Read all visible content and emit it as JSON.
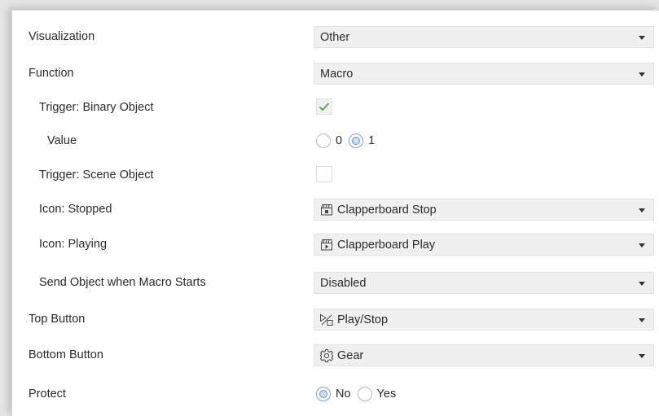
{
  "rows": [
    {
      "label": "Visualization",
      "type": "select",
      "value": "Other"
    },
    {
      "label": "Function",
      "type": "select",
      "value": "Macro"
    },
    {
      "label": "Trigger: Binary Object",
      "type": "checkbox",
      "checked": true
    },
    {
      "label": "Value",
      "type": "radio",
      "options": [
        "0",
        "1"
      ],
      "selected": "1"
    },
    {
      "label": "Trigger: Scene Object",
      "type": "checkbox",
      "checked": false
    },
    {
      "label": "Icon: Stopped",
      "type": "select",
      "value": "Clapperboard Stop",
      "icon": "clapperboard-stop-icon"
    },
    {
      "label": "Icon: Playing",
      "type": "select",
      "value": "Clapperboard Play",
      "icon": "clapperboard-play-icon"
    },
    {
      "label": "Send Object when Macro Starts",
      "type": "select",
      "value": "Disabled"
    },
    {
      "label": "Top Button",
      "type": "select",
      "value": "Play/Stop",
      "icon": "play-stop-icon"
    },
    {
      "label": "Bottom Button",
      "type": "select",
      "value": "Gear",
      "icon": "gear-icon"
    },
    {
      "label": "Protect",
      "type": "radio",
      "options": [
        "No",
        "Yes"
      ],
      "selected": "No"
    }
  ],
  "colors": {
    "panel_bg": "#ffffff",
    "select_bg": "#f0f0f0",
    "check_green": "#5aab5a",
    "radio_blue": "#6a8fca"
  }
}
